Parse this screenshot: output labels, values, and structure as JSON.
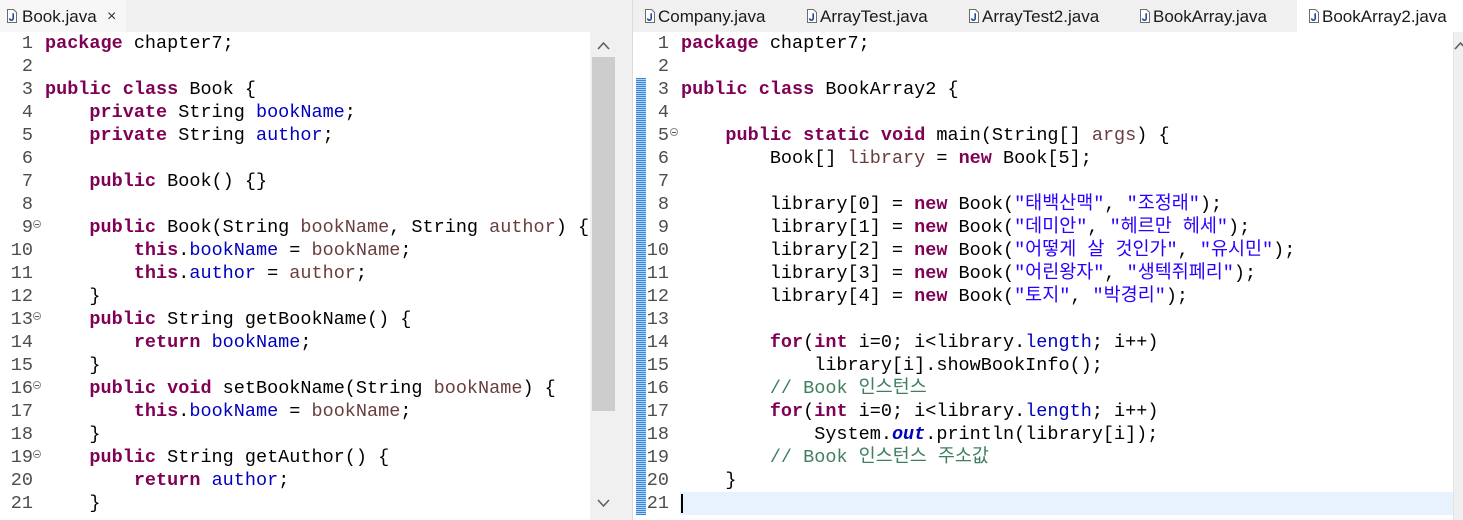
{
  "colors": {
    "keyword": "#7f0055",
    "field": "#0000c0",
    "variable": "#6a3e3e",
    "string": "#2a00ff",
    "comment": "#3f7f5f",
    "current_line": "#e8f2fe",
    "line_number": "#4d4d4d",
    "scope_indicator": "#3a86d8"
  },
  "left": {
    "tabs": [
      {
        "label": "Book.java",
        "close": "×",
        "icon": "java-file-icon",
        "active": true
      }
    ],
    "scrollbar": {
      "position": 0,
      "visible_fraction": 0.816
    },
    "lines": [
      {
        "n": "1",
        "t": [
          {
            "kw": "package"
          },
          {
            "p": " chapter7;"
          }
        ]
      },
      {
        "n": "2",
        "t": []
      },
      {
        "n": "3",
        "t": [
          {
            "kw": "public"
          },
          {
            "p": " "
          },
          {
            "kw": "class"
          },
          {
            "p": " Book {"
          }
        ]
      },
      {
        "n": "4",
        "t": [
          {
            "p": "    "
          },
          {
            "kw": "private"
          },
          {
            "p": " String "
          },
          {
            "fld": "bookName"
          },
          {
            "p": ";"
          }
        ]
      },
      {
        "n": "5",
        "t": [
          {
            "p": "    "
          },
          {
            "kw": "private"
          },
          {
            "p": " String "
          },
          {
            "fld": "author"
          },
          {
            "p": ";"
          }
        ]
      },
      {
        "n": "6",
        "t": []
      },
      {
        "n": "7",
        "t": [
          {
            "p": "    "
          },
          {
            "kw": "public"
          },
          {
            "p": " Book() {}"
          }
        ]
      },
      {
        "n": "8",
        "t": []
      },
      {
        "n": "9",
        "fold": true,
        "t": [
          {
            "p": "    "
          },
          {
            "kw": "public"
          },
          {
            "p": " Book(String "
          },
          {
            "var": "bookName"
          },
          {
            "p": ", String "
          },
          {
            "var": "author"
          },
          {
            "p": ") {"
          }
        ]
      },
      {
        "n": "10",
        "t": [
          {
            "p": "        "
          },
          {
            "kw": "this"
          },
          {
            "p": "."
          },
          {
            "fld": "bookName"
          },
          {
            "p": " = "
          },
          {
            "var": "bookName"
          },
          {
            "p": ";"
          }
        ]
      },
      {
        "n": "11",
        "t": [
          {
            "p": "        "
          },
          {
            "kw": "this"
          },
          {
            "p": "."
          },
          {
            "fld": "author"
          },
          {
            "p": " = "
          },
          {
            "var": "author"
          },
          {
            "p": ";"
          }
        ]
      },
      {
        "n": "12",
        "t": [
          {
            "p": "    }"
          }
        ]
      },
      {
        "n": "13",
        "fold": true,
        "t": [
          {
            "p": "    "
          },
          {
            "kw": "public"
          },
          {
            "p": " String getBookName() {"
          }
        ]
      },
      {
        "n": "14",
        "t": [
          {
            "p": "        "
          },
          {
            "kw": "return"
          },
          {
            "p": " "
          },
          {
            "fld": "bookName"
          },
          {
            "p": ";"
          }
        ]
      },
      {
        "n": "15",
        "t": [
          {
            "p": "    }"
          }
        ]
      },
      {
        "n": "16",
        "fold": true,
        "t": [
          {
            "p": "    "
          },
          {
            "kw": "public"
          },
          {
            "p": " "
          },
          {
            "kw": "void"
          },
          {
            "p": " setBookName(String "
          },
          {
            "var": "bookName"
          },
          {
            "p": ") {"
          }
        ]
      },
      {
        "n": "17",
        "t": [
          {
            "p": "        "
          },
          {
            "kw": "this"
          },
          {
            "p": "."
          },
          {
            "fld": "bookName"
          },
          {
            "p": " = "
          },
          {
            "var": "bookName"
          },
          {
            "p": ";"
          }
        ]
      },
      {
        "n": "18",
        "t": [
          {
            "p": "    }"
          }
        ]
      },
      {
        "n": "19",
        "fold": true,
        "t": [
          {
            "p": "    "
          },
          {
            "kw": "public"
          },
          {
            "p": " String getAuthor() {"
          }
        ]
      },
      {
        "n": "20",
        "t": [
          {
            "p": "        "
          },
          {
            "kw": "return"
          },
          {
            "p": " "
          },
          {
            "fld": "author"
          },
          {
            "p": ";"
          }
        ]
      },
      {
        "n": "21",
        "t": [
          {
            "p": "    }"
          }
        ]
      }
    ]
  },
  "right": {
    "tabs": [
      {
        "label": "Company.java",
        "icon": "java-file-icon",
        "active": false
      },
      {
        "label": "ArrayTest.java",
        "icon": "java-file-icon",
        "active": false
      },
      {
        "label": "ArrayTest2.java",
        "icon": "java-file-icon",
        "active": false
      },
      {
        "label": "BookArray.java",
        "icon": "java-file-icon",
        "active": false
      },
      {
        "label": "BookArray2.java",
        "icon": "java-file-icon",
        "active": true
      }
    ],
    "lines": [
      {
        "n": "1",
        "t": [
          {
            "kw": "package"
          },
          {
            "p": " chapter7;"
          }
        ]
      },
      {
        "n": "2",
        "t": []
      },
      {
        "n": "3",
        "t": [
          {
            "kw": "public"
          },
          {
            "p": " "
          },
          {
            "kw": "class"
          },
          {
            "p": " BookArray2 {"
          }
        ]
      },
      {
        "n": "4",
        "t": []
      },
      {
        "n": "5",
        "fold": true,
        "t": [
          {
            "p": "    "
          },
          {
            "kw": "public"
          },
          {
            "p": " "
          },
          {
            "kw": "static"
          },
          {
            "p": " "
          },
          {
            "kw": "void"
          },
          {
            "p": " main(String[] "
          },
          {
            "var": "args"
          },
          {
            "p": ") {"
          }
        ]
      },
      {
        "n": "6",
        "t": [
          {
            "p": "        Book[] "
          },
          {
            "var": "library"
          },
          {
            "p": " = "
          },
          {
            "kw": "new"
          },
          {
            "p": " Book[5];"
          }
        ]
      },
      {
        "n": "7",
        "t": []
      },
      {
        "n": "8",
        "t": [
          {
            "p": "        library[0] = "
          },
          {
            "kw": "new"
          },
          {
            "p": " Book("
          },
          {
            "str": "\"태백산맥\""
          },
          {
            "p": ", "
          },
          {
            "str": "\"조정래\""
          },
          {
            "p": ");"
          }
        ]
      },
      {
        "n": "9",
        "t": [
          {
            "p": "        library[1] = "
          },
          {
            "kw": "new"
          },
          {
            "p": " Book("
          },
          {
            "str": "\"데미안\""
          },
          {
            "p": ", "
          },
          {
            "str": "\"헤르만 헤세\""
          },
          {
            "p": ");"
          }
        ]
      },
      {
        "n": "10",
        "t": [
          {
            "p": "        library[2] = "
          },
          {
            "kw": "new"
          },
          {
            "p": " Book("
          },
          {
            "str": "\"어떻게 살 것인가\""
          },
          {
            "p": ", "
          },
          {
            "str": "\"유시민\""
          },
          {
            "p": ");"
          }
        ]
      },
      {
        "n": "11",
        "t": [
          {
            "p": "        library[3] = "
          },
          {
            "kw": "new"
          },
          {
            "p": " Book("
          },
          {
            "str": "\"어린왕자\""
          },
          {
            "p": ", "
          },
          {
            "str": "\"생텍쥐페리\""
          },
          {
            "p": ");"
          }
        ]
      },
      {
        "n": "12",
        "t": [
          {
            "p": "        library[4] = "
          },
          {
            "kw": "new"
          },
          {
            "p": " Book("
          },
          {
            "str": "\"토지\""
          },
          {
            "p": ", "
          },
          {
            "str": "\"박경리\""
          },
          {
            "p": ");"
          }
        ]
      },
      {
        "n": "13",
        "t": []
      },
      {
        "n": "14",
        "t": [
          {
            "p": "        "
          },
          {
            "kw": "for"
          },
          {
            "p": "("
          },
          {
            "kw": "int"
          },
          {
            "p": " i=0; i<library."
          },
          {
            "fld": "length"
          },
          {
            "p": "; i++)"
          }
        ]
      },
      {
        "n": "15",
        "t": [
          {
            "p": "            library[i].showBookInfo();"
          }
        ]
      },
      {
        "n": "16",
        "t": [
          {
            "p": "        "
          },
          {
            "cmt": "// Book 인스턴스"
          }
        ]
      },
      {
        "n": "17",
        "t": [
          {
            "p": "        "
          },
          {
            "kw": "for"
          },
          {
            "p": "("
          },
          {
            "kw": "int"
          },
          {
            "p": " i=0; i<library."
          },
          {
            "fld": "length"
          },
          {
            "p": "; i++)"
          }
        ]
      },
      {
        "n": "18",
        "t": [
          {
            "p": "            System."
          },
          {
            "sfld": "out"
          },
          {
            "p": ".println(library[i]);"
          }
        ]
      },
      {
        "n": "19",
        "t": [
          {
            "p": "        "
          },
          {
            "cmt": "// Book 인스턴스 주소값"
          }
        ]
      },
      {
        "n": "20",
        "t": [
          {
            "p": "    }"
          }
        ]
      },
      {
        "n": "21",
        "current": true,
        "t": []
      }
    ]
  }
}
